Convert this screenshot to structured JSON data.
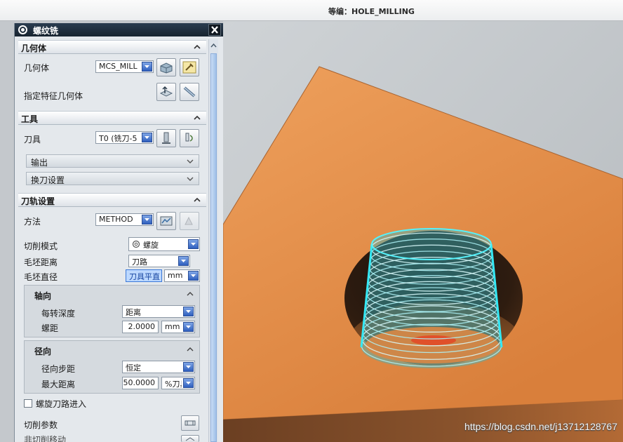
{
  "top_bar": {
    "status": "等编：HOLE_MILLING"
  },
  "dialog": {
    "title": "螺纹铣",
    "geometry": {
      "header": "几何体",
      "geometry_label": "几何体",
      "geometry_value": "MCS_MILL",
      "feature_label": "指定特征几何体"
    },
    "tool": {
      "header": "工具",
      "tool_label": "刀具",
      "tool_value": "T0 (铣刀-5",
      "output_label": "输出",
      "tool_change_label": "换刀设置"
    },
    "path_settings": {
      "header": "刀轨设置",
      "method_label": "方法",
      "method_value": "METHOD",
      "cut_pattern_label": "切削模式",
      "cut_pattern_value": "螺旋",
      "blank_distance_label": "毛坯距离",
      "blank_distance_value": "刀路",
      "blank_diameter_label": "毛坯直径",
      "blank_diameter_value": "刀具平直",
      "blank_diameter_unit": "mm",
      "axial": {
        "header": "轴向",
        "depth_label": "每转深度",
        "depth_value": "距离",
        "pitch_label": "螺距",
        "pitch_value": "2.0000",
        "pitch_unit": "mm"
      },
      "radial": {
        "header": "径向",
        "step_label": "径向步距",
        "step_value": "恒定",
        "max_label": "最大距离",
        "max_value": "50.0000",
        "max_unit": "%刀具"
      },
      "helical_entry_label": "螺旋刀路进入",
      "helical_entry_checked": false,
      "cut_params_label": "切削参数",
      "non_cut_label": "非切削移动"
    }
  },
  "watermark": "https://blog.csdn.net/j13712128767",
  "colors": {
    "title_bar": "#1f2e3d",
    "accent": "#2f5fbf",
    "plate": "#e38c45",
    "toolpath": "#3fe0f0",
    "highlight_input": "#bcd8ff"
  }
}
